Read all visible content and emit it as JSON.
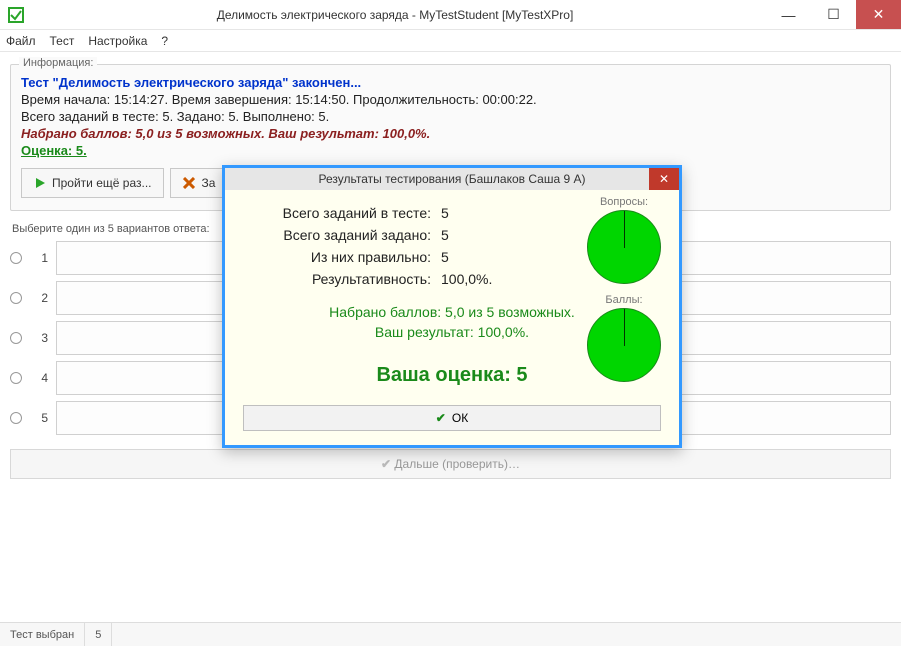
{
  "window": {
    "title": "Делимость электрического заряда - MyTestStudent [MyTestXPro]"
  },
  "menu": {
    "file": "Файл",
    "test": "Тест",
    "settings": "Настройка",
    "help": "?"
  },
  "info": {
    "legend": "Информация:",
    "title": "Тест \"Делимость электрического заряда\" закончен...",
    "timing": "Время начала: 15:14:27. Время завершения: 15:14:50. Продолжительность: 00:00:22.",
    "tasks": "Всего заданий в тесте: 5. Задано: 5. Выполнено: 5.",
    "points": "Набрано баллов: 5,0 из 5 возможных. Ваш результат: 100,0%.",
    "grade": "Оценка: 5."
  },
  "toolbar": {
    "retry": "Пройти ещё раз...",
    "close": "За"
  },
  "selector_label": "Выберите один из 5 вариантов ответа:",
  "answers": {
    "n1": "1",
    "n2": "2",
    "n3": "3",
    "n4": "4",
    "n5": "5"
  },
  "next_btn": "Дальше (проверить)…",
  "status": {
    "seg1": "Тест выбран",
    "seg2": "5"
  },
  "dialog": {
    "title": "Результаты тестирования (Башлаков Саша 9 А)",
    "rows": {
      "r1k": "Всего заданий в тесте:",
      "r1v": "5",
      "r2k": "Всего заданий задано:",
      "r2v": "5",
      "r3k": "Из них правильно:",
      "r3v": "5",
      "r4k": "Результативность:",
      "r4v": "100,0%."
    },
    "points1": "Набрано баллов: 5,0 из 5 возможных.",
    "points2": "Ваш результат: 100,0%.",
    "grade": "Ваша оценка: 5",
    "ok": "ОК",
    "pie1": "Вопросы:",
    "pie2": "Баллы:"
  },
  "chart_data": [
    {
      "type": "pie",
      "title": "Вопросы:",
      "categories": [
        "Правильно"
      ],
      "values": [
        5
      ],
      "total": 5
    },
    {
      "type": "pie",
      "title": "Баллы:",
      "categories": [
        "Набрано"
      ],
      "values": [
        5.0
      ],
      "total": 5.0
    }
  ]
}
